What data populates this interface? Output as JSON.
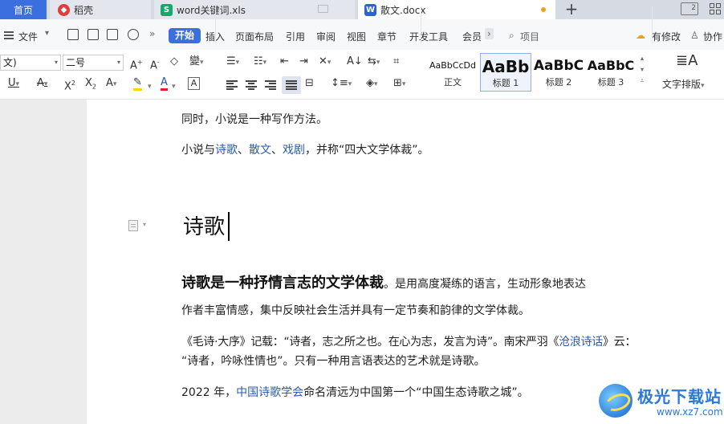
{
  "tabs": {
    "home": "首页",
    "daoke": "稻壳",
    "xls": "word关键词.xls",
    "doc": "散文.docx",
    "daoke_icon": "daoke-icon",
    "xls_icon_letter": "S",
    "doc_icon_letter": "W",
    "new_tab": "+",
    "window_count": "2"
  },
  "menu": {
    "file": "文件",
    "items": [
      "开始",
      "插入",
      "页面布局",
      "引用",
      "审阅",
      "视图",
      "章节",
      "开发工具",
      "会员"
    ],
    "search": "项目",
    "modify": "有修改",
    "collab": "协作"
  },
  "ribbon": {
    "font_name": "文)",
    "font_size": "二号",
    "styles": [
      {
        "preview": "AaBbCcDd",
        "label": "正文"
      },
      {
        "preview": "AaBb",
        "label": "标题 1"
      },
      {
        "preview": "AaBbC",
        "label": "标题 2"
      },
      {
        "preview": "AaBbC",
        "label": "标题 3"
      }
    ],
    "text_layout": "文字排版"
  },
  "colors": {
    "accent": "#3b6fe0",
    "link": "#2a5caa",
    "highlight": "#ffd400",
    "font_color": "#e02020"
  },
  "document": {
    "line1": "同时，小说是一种写作方法。",
    "line2_pre": "小说与",
    "line2_link1": "诗歌",
    "line2_sep1": "、",
    "line2_link2": "散文",
    "line2_sep2": "、",
    "line2_link3": "戏剧",
    "line2_post": "，并称“四大文学体裁”。",
    "heading": "诗歌",
    "p1_bold": "诗歌是一种抒情言志的文学体裁",
    "p1_rest": "。是用高度凝练的语言，生动形象地表达",
    "p1_line2": "作者丰富情感，集中反映社会生活并具有一定节奏和韵律的文学体裁。",
    "p2_pre": "《毛诗·大序》记载：“诗者，志之所之也。在心为志，发言为诗”。南宋严羽《",
    "p2_link": "沧浪诗话",
    "p2_post": "》云：",
    "p2_line2": "“诗者，吟咏性情也”。只有一种用言语表达的艺术就是诗歌。",
    "p3_pre": "2022 年，",
    "p3_link": "中国诗歌学会",
    "p3_post": "命名清远为中国第一个“中国生态诗歌之城”。"
  },
  "watermark": {
    "title": "极光下载站",
    "url": "www.xz7.com"
  }
}
